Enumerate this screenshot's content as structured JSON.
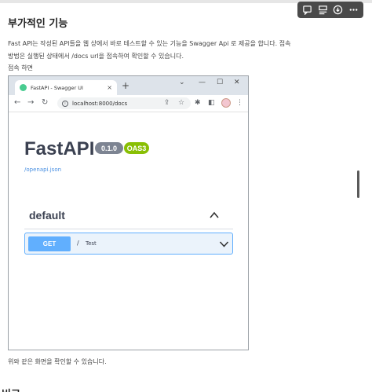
{
  "article": {
    "title": "부가적인 기능",
    "para_line1": "Fast API는 작성된 API들을 웹 상에서 바로 테스트할 수 있는 기능을 Swagger Api 로 제공을 합니다. 접속",
    "para_line2": "방법은 실행된 상태에서 /docs url을 접속하여 확인할 수 있습니다.",
    "para_line3": "접속 하면",
    "after_image": "위와 같은 화면을 확인할 수 있습니다.",
    "next_heading_partial": "비교"
  },
  "toolbar": {
    "icons": [
      "comment-icon",
      "layout-icon",
      "download-icon",
      "more-icon"
    ]
  },
  "browser": {
    "tab_title": "FastAPI - Swagger UI",
    "tab_close": "×",
    "new_tab": "+",
    "url": "localhost:8000/docs",
    "win_minimize": "⌄",
    "win_min": "—",
    "win_max": "☐",
    "win_close": "✕"
  },
  "swagger": {
    "title": "FastAPI",
    "version": "0.1.0",
    "oas": "OAS3",
    "spec_link": "/openapi.json",
    "section": "default",
    "operation": {
      "method": "GET",
      "path": "/",
      "summary": "Test"
    }
  },
  "colors": {
    "get_method": "#61affe",
    "oas_badge": "#89bf04",
    "version_badge": "#7d8492",
    "link": "#4990e2"
  }
}
